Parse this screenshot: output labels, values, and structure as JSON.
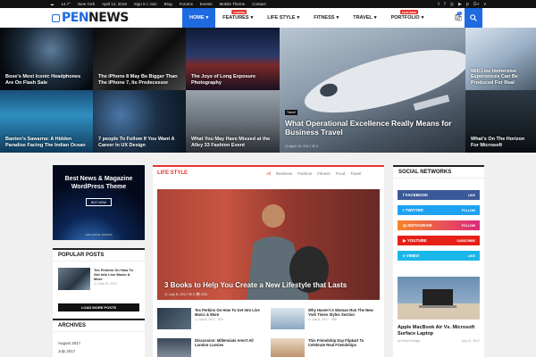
{
  "topbar": {
    "weather": "14.7°",
    "location": "New York",
    "date": "April 14, 2018",
    "signin": "Sign in / Join",
    "links": [
      "Blog",
      "Forums",
      "Events",
      "Mobile Theme",
      "Contact"
    ],
    "social_icons": [
      "twitter-icon",
      "facebook-icon",
      "instagram-icon",
      "youtube-icon",
      "pinterest-icon",
      "google-plus-icon",
      "vimeo-icon"
    ]
  },
  "header": {
    "logo_pen": "PEN",
    "logo_news": "NEWS",
    "nav": [
      {
        "label": "HOME",
        "active": true,
        "badge": "",
        "caret": true
      },
      {
        "label": "FEATURES",
        "active": false,
        "badge": "CHOOSE",
        "caret": true
      },
      {
        "label": "LIFE STYLE",
        "active": false,
        "badge": "",
        "caret": true
      },
      {
        "label": "FITNESS",
        "active": false,
        "badge": "",
        "caret": true
      },
      {
        "label": "TRAVEL",
        "active": false,
        "badge": "",
        "caret": true
      },
      {
        "label": "PORTFOLIO",
        "active": false,
        "badge": "FEATURES",
        "caret": true
      }
    ],
    "cart_count": "0"
  },
  "hero": {
    "tiles": [
      {
        "caption": "Bose's Most Iconic Headphones Are On Flash Sale"
      },
      {
        "caption": "The iPhone 8 May Be Bigger Than The iPhone 7, Its Predecessor"
      },
      {
        "caption": "The Joys of Long Exposure Photography"
      },
      {
        "caption": "What Operational Excellence Really Means for Business Travel",
        "tag": "Travel",
        "date": "April 20, 2017",
        "comments": "0"
      },
      {
        "caption": "Will Live Immersive Experiences Can Be Produced For Real"
      },
      {
        "caption": "Banten's Sawarna: A Hidden Paradise Facing The Indian Ocean"
      },
      {
        "caption": "7 people To Follow If You Want A Career in UX Design"
      },
      {
        "caption": "What You May Have Missed at the Alley 33 Fashion Event"
      },
      {
        "caption": "What's On The Horizon For Microsoft"
      }
    ]
  },
  "ad": {
    "title": "Best News & Magazine WordPress Theme",
    "button": "BUY NOW",
    "footer": "ADS SPACE 300X250"
  },
  "popular": {
    "title": "POPULAR POSTS",
    "item_title": "Tex Perkins On How To Get Into Live Music & More",
    "item_date": "June 20, 2017",
    "load_more": "LOAD MORE POSTS"
  },
  "archives": {
    "title": "ARCHIVES",
    "items": [
      "August 2017",
      "July 2017"
    ]
  },
  "lifestyle": {
    "title": "LIFE STYLE",
    "tabs": [
      "All",
      "Business",
      "Fashion",
      "Fitness",
      "Food",
      "Travel"
    ],
    "main_caption": "3 Books to Help You Create a New Lifestyle that Lasts",
    "main_date": "July 8, 2017",
    "main_comments": "0",
    "main_views": "604",
    "subs": [
      {
        "title": "Tex Perkins On How To Get Into Live Music & More",
        "date": "July 8, 2017",
        "views": "604"
      },
      {
        "title": "Why Haven't A Woman Run The New York Times Styles Section",
        "date": "July 8, 2017",
        "views": "488"
      },
      {
        "title": "Discussion: Millennials Aren't All London Luvvies",
        "date": "",
        "views": ""
      },
      {
        "title": "This Friendship Day Flipkart To Celebrate Real Friendships",
        "date": "",
        "views": ""
      }
    ]
  },
  "social": {
    "title": "SOCIAL NETWORKS",
    "buttons": [
      {
        "label": "FACEBOOK",
        "action": "LIKE",
        "color": "#3b5998"
      },
      {
        "label": "TWITTER",
        "action": "FOLLOW",
        "color": "#1da1f2"
      },
      {
        "label": "INSTAGRAM",
        "action": "FOLLOW",
        "color": "#e95950"
      },
      {
        "label": "YOUTUBE",
        "action": "SUBSCRIBE",
        "color": "#e62117"
      },
      {
        "label": "VIMEO",
        "action": "LIKE",
        "color": "#1ab7ea"
      }
    ],
    "article_title": "Apple MacBook Air Vs. Microsoft Surface Laptop",
    "article_author": "by Penci Design",
    "article_date": "July 11, 2017"
  },
  "colors": {
    "accent": "#1e6ae0",
    "red": "#e8352c"
  }
}
